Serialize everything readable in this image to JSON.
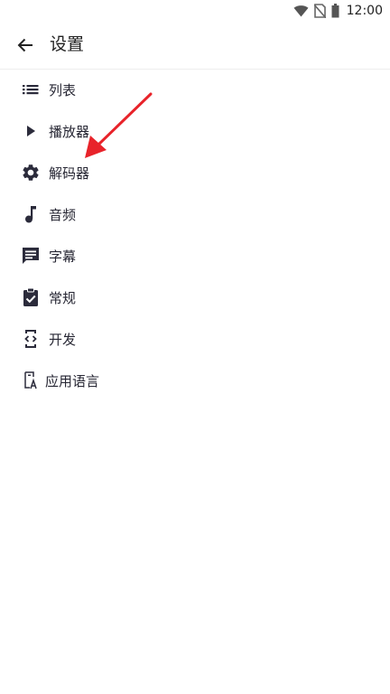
{
  "status_bar": {
    "time": "12:00"
  },
  "app_bar": {
    "title": "设置"
  },
  "menu": {
    "items": [
      {
        "label": "列表",
        "icon": "list-icon"
      },
      {
        "label": "播放器",
        "icon": "play-icon"
      },
      {
        "label": "解码器",
        "icon": "gear-icon"
      },
      {
        "label": "音频",
        "icon": "music-note-icon"
      },
      {
        "label": "字幕",
        "icon": "subtitle-icon"
      },
      {
        "label": "常规",
        "icon": "clipboard-check-icon"
      },
      {
        "label": "开发",
        "icon": "developer-icon"
      },
      {
        "label": "应用语言",
        "icon": "language-icon"
      }
    ]
  },
  "colors": {
    "icon": "#2b2b3b",
    "annotation_arrow": "#e8232a"
  }
}
